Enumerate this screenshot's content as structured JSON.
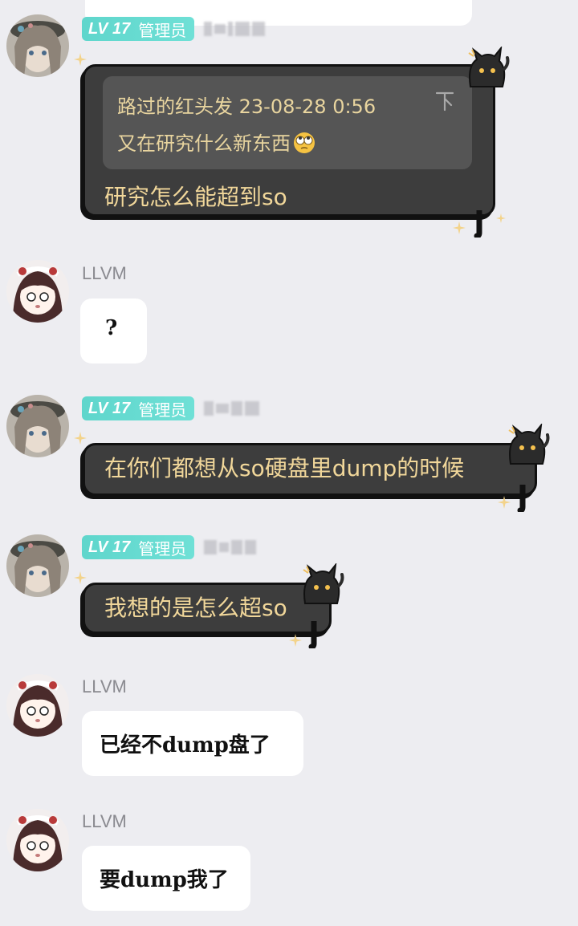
{
  "badge": {
    "level": "LV 17",
    "role": "管理员"
  },
  "messages": {
    "m1": {
      "reply": {
        "author_time": "路过的红头发 23-08-28 0:56",
        "text": "又在研究什么新东西"
      },
      "text": "研究怎么能超到so"
    },
    "m2": {
      "sender": "LLVM",
      "text": "?"
    },
    "m3": {
      "text": "在你们都想从so硬盘里dump的时候"
    },
    "m4": {
      "text": "我想的是怎么超so"
    },
    "m5": {
      "sender": "LLVM",
      "text": "已经不dump盘了"
    },
    "m6": {
      "sender": "LLVM",
      "text": "要dump我了"
    }
  },
  "colors": {
    "background": "#ededf1",
    "badge": "#5fd6cc",
    "dark_bubble": "#3d3d3d",
    "dark_text": "#f1d79a",
    "white_bubble": "#ffffff"
  },
  "icons": {
    "pin": "pin-icon",
    "emoji": "face-with-rolling-eyes-emoji",
    "decoration": "black-cat-icon"
  }
}
